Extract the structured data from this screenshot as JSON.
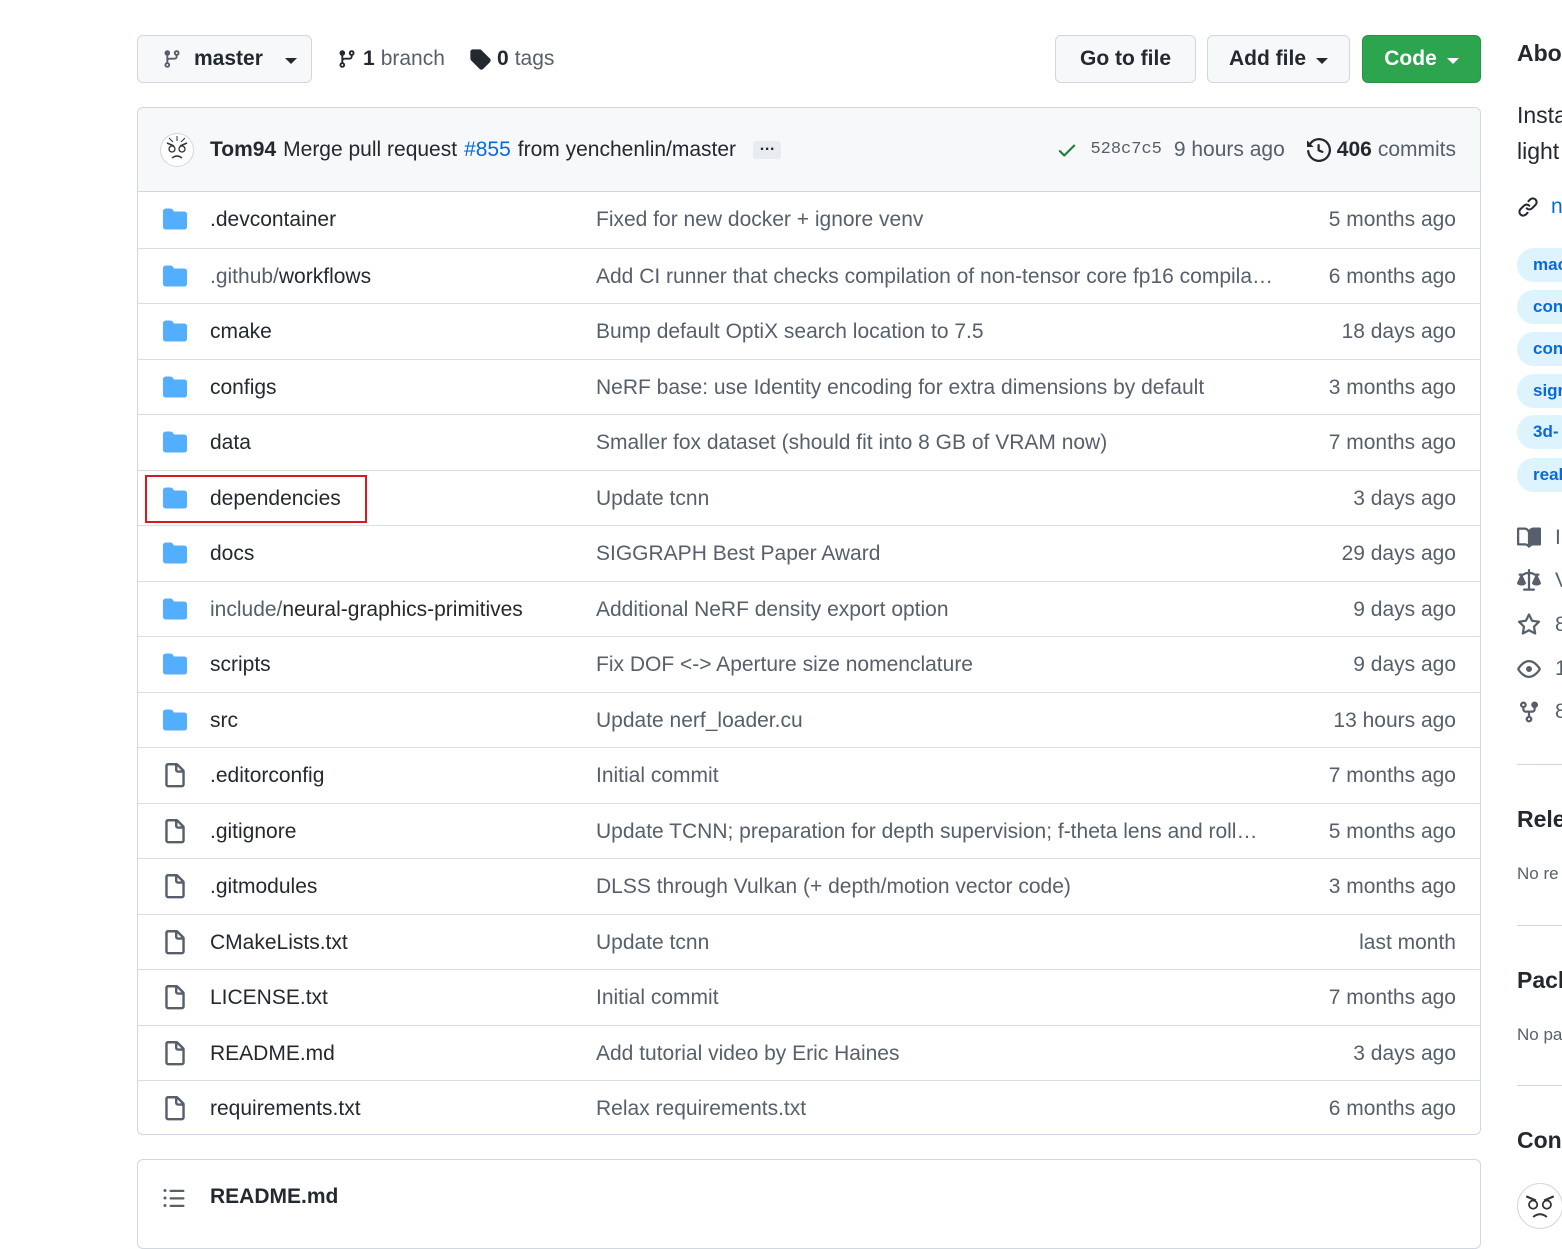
{
  "toolbar": {
    "branch": "master",
    "branch_count": "1",
    "branch_label": "branch",
    "tag_count": "0",
    "tag_label": "tags",
    "go_to_file": "Go to file",
    "add_file": "Add file",
    "code": "Code"
  },
  "commit": {
    "author": "Tom94",
    "message_prefix": "Merge pull request",
    "pr_link": "#855",
    "message_suffix": "from yenchenlin/master",
    "ellipsis": "…",
    "sha": "528c7c5",
    "time": "9 hours ago",
    "commit_count": "406",
    "commit_label": "commits"
  },
  "files": [
    {
      "type": "folder",
      "name": ".devcontainer",
      "message": "Fixed for new docker + ignore venv",
      "date": "5 months ago"
    },
    {
      "type": "folder",
      "name_dim": ".github/",
      "name": "workflows",
      "message": "Add CI runner that checks compilation of non-tensor core fp16 compila…",
      "date": "6 months ago"
    },
    {
      "type": "folder",
      "name": "cmake",
      "message": "Bump default OptiX search location to 7.5",
      "date": "18 days ago"
    },
    {
      "type": "folder",
      "name": "configs",
      "message": "NeRF base: use Identity encoding for extra dimensions by default",
      "date": "3 months ago"
    },
    {
      "type": "folder",
      "name": "data",
      "message": "Smaller fox dataset (should fit into 8 GB of VRAM now)",
      "date": "7 months ago"
    },
    {
      "type": "folder",
      "name": "dependencies",
      "message": "Update tcnn",
      "date": "3 days ago",
      "highlight": true
    },
    {
      "type": "folder",
      "name": "docs",
      "message": "SIGGRAPH Best Paper Award",
      "date": "29 days ago"
    },
    {
      "type": "folder",
      "name_dim": "include/",
      "name": "neural-graphics-primitives",
      "message": "Additional NeRF density export option",
      "date": "9 days ago"
    },
    {
      "type": "folder",
      "name": "scripts",
      "message": "Fix DOF <-> Aperture size nomenclature",
      "date": "9 days ago"
    },
    {
      "type": "folder",
      "name": "src",
      "message": "Update nerf_loader.cu",
      "date": "13 hours ago"
    },
    {
      "type": "file",
      "name": ".editorconfig",
      "message": "Initial commit",
      "date": "7 months ago"
    },
    {
      "type": "file",
      "name": ".gitignore",
      "message": "Update TCNN; preparation for depth supervision; f-theta lens and roll…",
      "date": "5 months ago"
    },
    {
      "type": "file",
      "name": ".gitmodules",
      "message": "DLSS through Vulkan (+ depth/motion vector code)",
      "date": "3 months ago"
    },
    {
      "type": "file",
      "name": "CMakeLists.txt",
      "message": "Update tcnn",
      "date": "last month"
    },
    {
      "type": "file",
      "name": "LICENSE.txt",
      "message": "Initial commit",
      "date": "7 months ago"
    },
    {
      "type": "file",
      "name": "README.md",
      "message": "Add tutorial video by Eric Haines",
      "date": "3 days ago"
    },
    {
      "type": "file",
      "name": "requirements.txt",
      "message": "Relax requirements.txt",
      "date": "6 months ago"
    }
  ],
  "readme": {
    "title": "README.md"
  },
  "sidebar": {
    "about_heading": "Abo",
    "desc_line1": "Insta",
    "desc_line2": "light",
    "link_text": "n",
    "topics": [
      "mac",
      "con",
      "con",
      "sigr",
      "3d-",
      "real"
    ],
    "stats": [
      "I",
      "V",
      "8",
      "1",
      "8"
    ],
    "releases_heading": "Rele",
    "releases_text": "No re",
    "packages_heading": "Pack",
    "packages_text": "No pa",
    "contributors_heading": "Con"
  },
  "colors": {
    "accent": "#0969da",
    "primary_button": "#2da44e",
    "folder": "#54aeff",
    "highlight_box": "#d71a21",
    "check": "#1a7f37"
  }
}
